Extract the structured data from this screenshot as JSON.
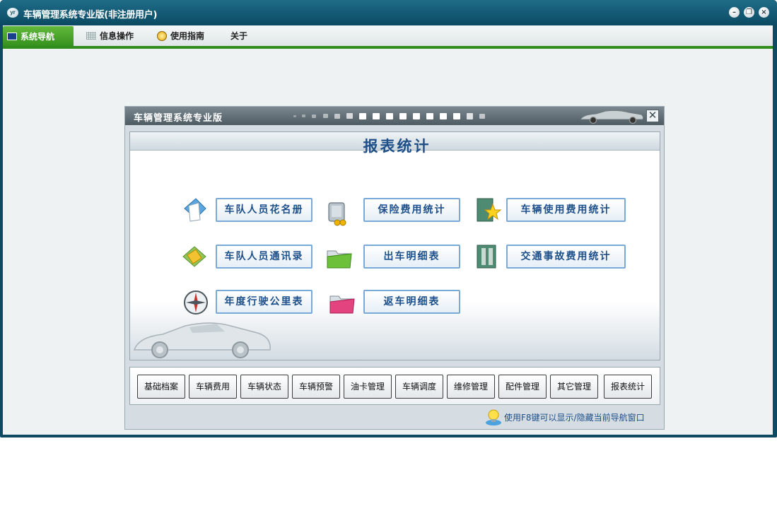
{
  "window": {
    "title": "车辆管理系统专业版(非注册用户)",
    "logo_text": "yr",
    "minimize_glyph": "–",
    "restore_glyph": "❐",
    "close_glyph": "×"
  },
  "menu": {
    "items": [
      {
        "label": "系统导航",
        "icon": "monitor-icon",
        "active": true
      },
      {
        "label": "信息操作",
        "icon": "grid-icon",
        "active": false
      },
      {
        "label": "使用指南",
        "icon": "help-icon",
        "active": false
      },
      {
        "label": "关于",
        "icon": "",
        "active": false
      }
    ]
  },
  "panel": {
    "title": "车辆管理系统专业版",
    "close_glyph": "✕",
    "section_title": "报表统计",
    "reports": [
      {
        "label": "车队人员花名册",
        "icon": "document-icon"
      },
      {
        "label": "保险费用统计",
        "icon": "safe-coins-icon"
      },
      {
        "label": "车辆使用费用统计",
        "icon": "star-book-icon"
      },
      {
        "label": "车队人员通讯录",
        "icon": "address-book-icon"
      },
      {
        "label": "出车明细表",
        "icon": "green-folder-icon"
      },
      {
        "label": "交通事故费用统计",
        "icon": "binder-icon"
      },
      {
        "label": "年度行驶公里表",
        "icon": "compass-icon"
      },
      {
        "label": "返车明细表",
        "icon": "pink-folder-icon"
      }
    ],
    "modules": [
      "基础档案",
      "车辆费用",
      "车辆状态",
      "车辆预警",
      "油卡管理",
      "车辆调度",
      "维修管理",
      "配件管理",
      "其它管理",
      "报表统计"
    ],
    "tip": "使用F8键可以显示/隐藏当前导航窗口"
  },
  "colors": {
    "title_bar": "#0e4a62",
    "menu_active": "#3d9a22",
    "accent_blue": "#1d4f8a",
    "button_border": "#79a9d6"
  }
}
